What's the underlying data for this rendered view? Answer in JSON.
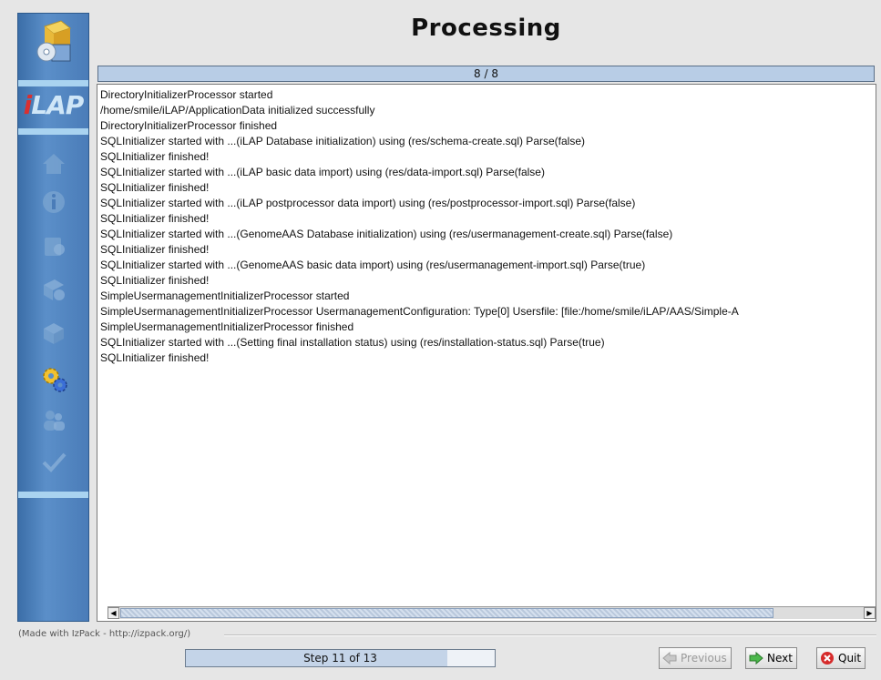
{
  "window": {
    "title": "Processing"
  },
  "sidebar": {
    "logo_text_i": "i",
    "logo_text_rest": "LAP",
    "steps": [
      {
        "name": "home-icon"
      },
      {
        "name": "info-icon"
      },
      {
        "name": "license-icon"
      },
      {
        "name": "packs-icon"
      },
      {
        "name": "target-icon"
      },
      {
        "name": "processing-gears-icon",
        "active": true
      },
      {
        "name": "users-icon"
      },
      {
        "name": "finish-check-icon"
      }
    ]
  },
  "pack_progress": {
    "label": "8 / 8",
    "fraction": 1.0
  },
  "log": {
    "lines": [
      "DirectoryInitializerProcessor started",
      "/home/smile/iLAP/ApplicationData initialized successfully",
      "DirectoryInitializerProcessor finished",
      "SQLInitializer started with ...(iLAP Database initialization) using (res/schema-create.sql) Parse(false)",
      "SQLInitializer finished!",
      "SQLInitializer started with ...(iLAP basic data import) using (res/data-import.sql) Parse(false)",
      "SQLInitializer finished!",
      "SQLInitializer started with ...(iLAP postprocessor data import) using (res/postprocessor-import.sql) Parse(false)",
      "SQLInitializer finished!",
      "SQLInitializer started with ...(GenomeAAS Database initialization) using (res/usermanagement-create.sql) Parse(false)",
      "SQLInitializer finished!",
      "SQLInitializer started with ...(GenomeAAS basic data import) using (res/usermanagement-import.sql) Parse(true)",
      "SQLInitializer finished!",
      "SimpleUsermanagementInitializerProcessor started",
      "SimpleUsermanagementInitializerProcessor UsermanagementConfiguration: Type[0] Usersfile: [file:/home/smile/iLAP/AAS/Simple-A",
      "SimpleUsermanagementInitializerProcessor finished",
      "SQLInitializer started with ...(Setting final installation status) using (res/installation-status.sql) Parse(true)",
      "SQLInitializer finished!"
    ]
  },
  "footer": {
    "made_with": "(Made with IzPack - http://izpack.org/)",
    "step_label": "Step 11 of 13",
    "step_fraction": 0.846,
    "previous_label": "Previous",
    "next_label": "Next",
    "quit_label": "Quit"
  },
  "colors": {
    "sidebar": "#4a7cb8",
    "accent": "#a9d3f0"
  }
}
